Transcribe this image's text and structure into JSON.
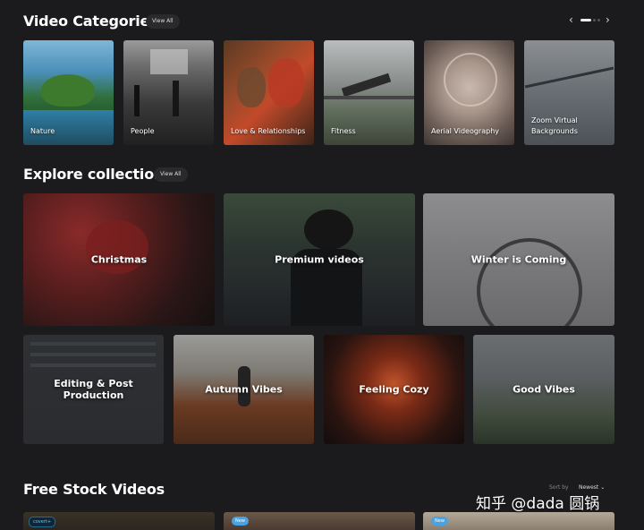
{
  "video_categories": {
    "title": "Video Categories",
    "view_all": "View All",
    "items": [
      {
        "label": "Nature"
      },
      {
        "label": "People"
      },
      {
        "label": "Love & Relationships"
      },
      {
        "label": "Fitness"
      },
      {
        "label": "Aerial Videography"
      },
      {
        "label": "Zoom Virtual Backgrounds"
      }
    ],
    "carousel": {
      "pages": 3,
      "active_page": 1
    }
  },
  "collections": {
    "title": "Explore collections",
    "view_all": "View All",
    "items": [
      {
        "label": "Christmas"
      },
      {
        "label": "Premium videos"
      },
      {
        "label": "Winter is Coming"
      },
      {
        "label": "Editing & Post Production"
      },
      {
        "label": "Autumn Vibes"
      },
      {
        "label": "Feeling Cozy"
      },
      {
        "label": "Good Vibes"
      }
    ]
  },
  "free_stock": {
    "title": "Free Stock Videos",
    "sort_label": "Sort by",
    "sort_value": "Newest",
    "badges": {
      "brand": "covert+",
      "new": "New"
    }
  },
  "watermark": "知乎 @dada 圆锅"
}
